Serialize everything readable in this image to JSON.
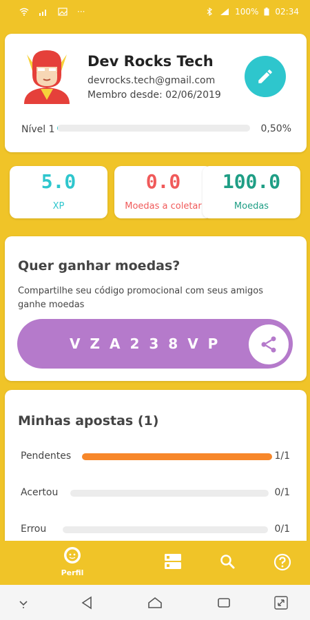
{
  "status_bar": {
    "battery": "100%",
    "time": "02:34"
  },
  "profile": {
    "name": "Dev Rocks Tech",
    "email": "devrocks.tech@gmail.com",
    "member_since": "Membro desde: 02/06/2019",
    "level_label": "Nível 1",
    "level_progress_percent": 0.5,
    "level_progress_text": "0,50%"
  },
  "stats": [
    {
      "value": "5.0",
      "label": "XP",
      "color": "#2EC6CD"
    },
    {
      "value": "0.0",
      "label": "Moedas a coletar",
      "color": "#F05A5A"
    },
    {
      "value": "100.0",
      "label": "Moedas",
      "color": "#1F9E85"
    }
  ],
  "invite": {
    "title": "Quer ganhar moedas?",
    "description": "Compartilhe seu código promocional com seus amigos ganhe moedas",
    "promo_code": "VZA238VP"
  },
  "bets": {
    "title": "Minhas apostas (1)",
    "rows": [
      {
        "label": "Pendentes",
        "count": "1/1",
        "fraction": 1.0
      },
      {
        "label": "Acertou",
        "count": "0/1",
        "fraction": 0.0
      },
      {
        "label": "Errou",
        "count": "0/1",
        "fraction": 0.0
      }
    ]
  },
  "tabbar": {
    "items": [
      {
        "label": "Perfil",
        "icon": "face-icon",
        "active": true
      },
      {
        "label": "",
        "icon": "list-icon",
        "active": false
      },
      {
        "label": "",
        "icon": "search-icon",
        "active": false
      },
      {
        "label": "",
        "icon": "help-icon",
        "active": false
      }
    ]
  },
  "colors": {
    "background": "#F0C428",
    "accent_teal": "#2EC6CD",
    "promo_purple": "#B57ACB",
    "pending_orange": "#F7872A"
  }
}
